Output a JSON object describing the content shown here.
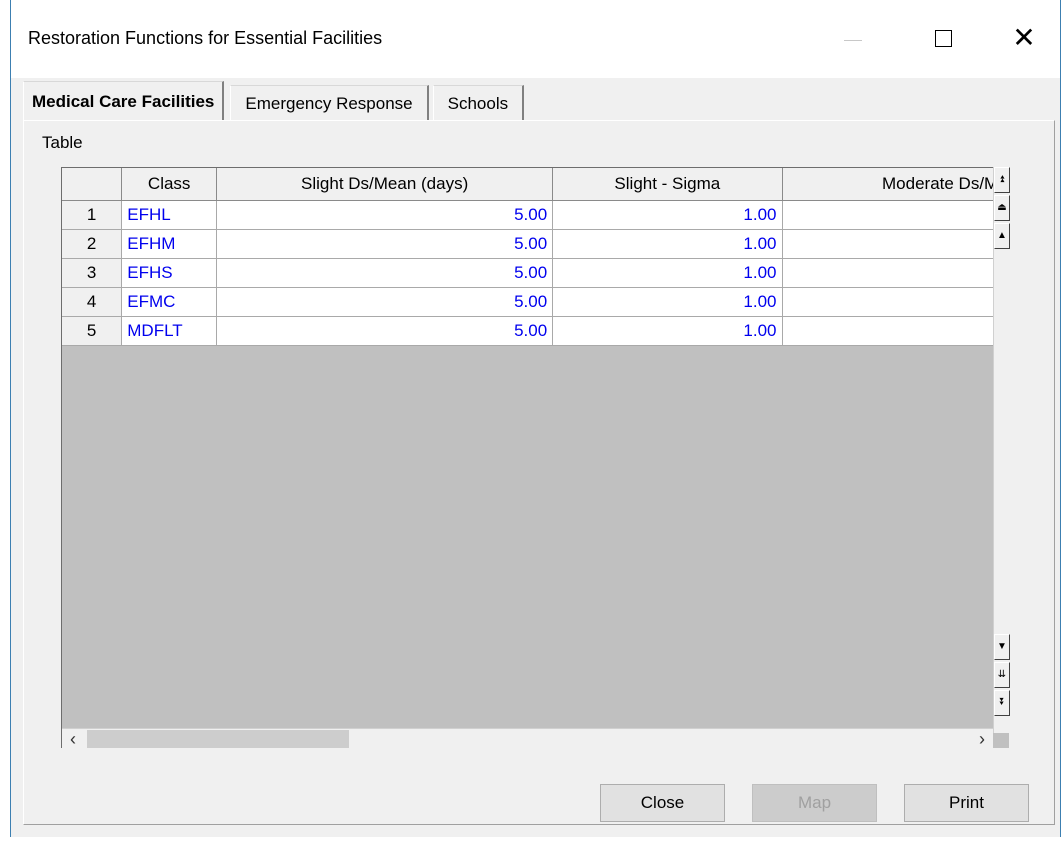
{
  "window": {
    "title": "Restoration Functions for Essential Facilities"
  },
  "tabs": [
    {
      "label": "Medical Care Facilities",
      "active": true
    },
    {
      "label": "Emergency Response",
      "active": false
    },
    {
      "label": "Schools",
      "active": false
    }
  ],
  "table_label": "Table",
  "grid": {
    "columns": [
      "",
      "Class",
      "Slight Ds/Mean (days)",
      "Slight - Sigma",
      "Moderate Ds/Mi"
    ],
    "rows": [
      {
        "num": "1",
        "class": "EFHL",
        "slight_mean": "5.00",
        "slight_sigma": "1.00"
      },
      {
        "num": "2",
        "class": "EFHM",
        "slight_mean": "5.00",
        "slight_sigma": "1.00"
      },
      {
        "num": "3",
        "class": "EFHS",
        "slight_mean": "5.00",
        "slight_sigma": "1.00"
      },
      {
        "num": "4",
        "class": "EFMC",
        "slight_mean": "5.00",
        "slight_sigma": "1.00"
      },
      {
        "num": "5",
        "class": "MDFLT",
        "slight_mean": "5.00",
        "slight_sigma": "1.00"
      }
    ],
    "value_color": "#0000ee",
    "empty_area_color": "#c0c0c0"
  },
  "buttons": {
    "close": "Close",
    "map": "Map",
    "print": "Print"
  },
  "icons": {
    "minimize": "minimize-icon",
    "maximize": "maximize-icon",
    "close": "close-icon",
    "scroll_top": "scroll-top-icon",
    "page_up": "page-up-icon",
    "line_up": "arrow-up-icon",
    "line_down": "arrow-down-icon",
    "page_down": "page-down-icon",
    "scroll_bottom": "scroll-bottom-icon",
    "left": "chevron-left-icon",
    "right": "chevron-right-icon"
  }
}
